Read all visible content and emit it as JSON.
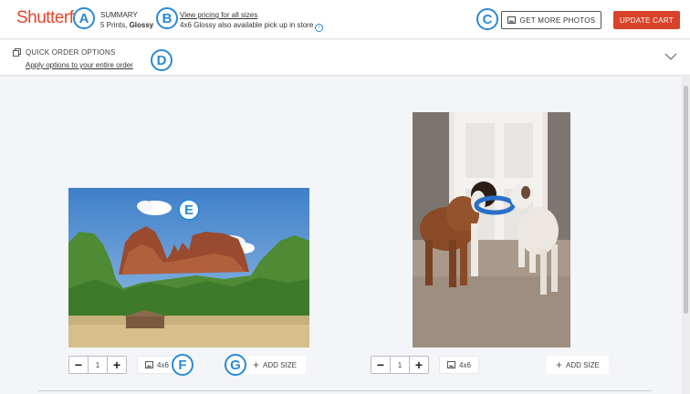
{
  "header": {
    "logo": "Shutterf",
    "summary_title": "SUMMARY",
    "summary_detail_prints": "5 Prints, ",
    "summary_detail_finish": "Glossy",
    "pricing_link": "View pricing for all sizes",
    "pickup_note": "4x6 Glossy also available pick up in store",
    "get_more_label": "GET MORE PHOTOS",
    "update_cart_label": "UPDATE CART"
  },
  "quick_order": {
    "title": "QUICK ORDER OPTIONS",
    "apply_link": "Apply options to your entire order"
  },
  "photos": [
    {
      "quantity": "1",
      "size": "4x6",
      "add_size_label": "ADD SIZE"
    },
    {
      "quantity": "1",
      "size": "4x6",
      "add_size_label": "ADD SIZE"
    }
  ],
  "markers": [
    "A",
    "B",
    "C",
    "D",
    "E",
    "F",
    "G"
  ],
  "colors": {
    "brand": "#e3462b",
    "cta": "#d9432a",
    "marker": "#2a8ad4"
  }
}
